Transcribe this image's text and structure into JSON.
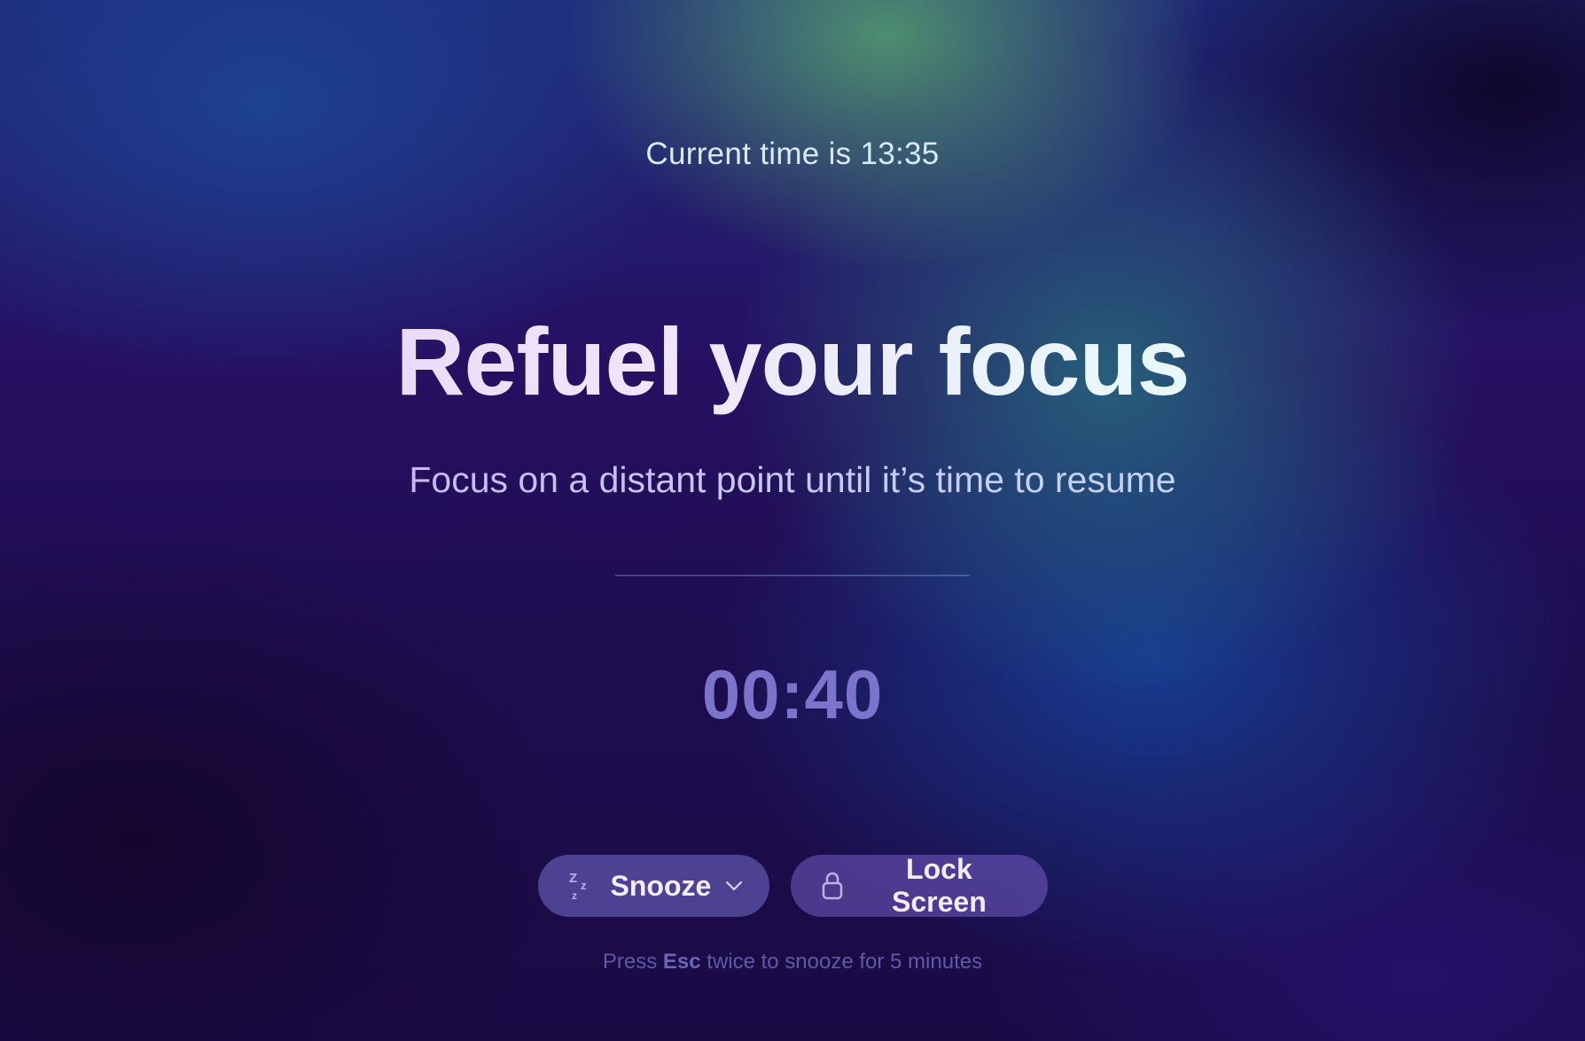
{
  "header": {
    "current_time": "Current time is 13:35"
  },
  "main": {
    "headline": "Refuel your focus",
    "subtitle": "Focus on a distant point until it’s time to resume",
    "countdown": "00:40"
  },
  "actions": {
    "snooze": {
      "label": "Snooze",
      "icon": "snooze-zzz-icon",
      "dropdown_icon": "chevron-down-icon"
    },
    "lock": {
      "label": "Lock Screen",
      "icon": "lock-icon"
    }
  },
  "hint": {
    "prefix": "Press ",
    "key": "Esc",
    "suffix": " twice to snooze for 5 minutes"
  }
}
